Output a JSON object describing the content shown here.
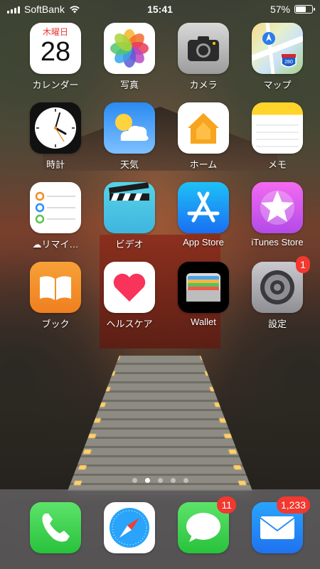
{
  "status_bar": {
    "carrier": "SoftBank",
    "time": "15:41",
    "battery_text": "57%",
    "battery_level": 0.57
  },
  "apps": [
    {
      "label": "カレンダー",
      "icon": "calendar-icon",
      "calendar_weekday": "木曜日",
      "calendar_day": "28"
    },
    {
      "label": "写真",
      "icon": "photos-icon"
    },
    {
      "label": "カメラ",
      "icon": "camera-icon"
    },
    {
      "label": "マップ",
      "icon": "maps-icon",
      "sign_text": "280"
    },
    {
      "label": "時計",
      "icon": "clock-icon"
    },
    {
      "label": "天気",
      "icon": "weather-icon"
    },
    {
      "label": "ホーム",
      "icon": "home-icon"
    },
    {
      "label": "メモ",
      "icon": "notes-icon"
    },
    {
      "label": "リマイ…",
      "icon": "reminders-icon"
    },
    {
      "label": "ビデオ",
      "icon": "videos-icon"
    },
    {
      "label": "App Store",
      "icon": "app-store-icon"
    },
    {
      "label": "iTunes Store",
      "icon": "itunes-store-icon"
    },
    {
      "label": "ブック",
      "icon": "books-icon"
    },
    {
      "label": "ヘルスケア",
      "icon": "health-icon"
    },
    {
      "label": "Wallet",
      "icon": "wallet-icon"
    },
    {
      "label": "設定",
      "icon": "settings-icon",
      "badge": "1"
    }
  ],
  "page_indicator": {
    "count": 5,
    "active": 1
  },
  "dock": [
    {
      "icon": "phone-icon"
    },
    {
      "icon": "safari-icon"
    },
    {
      "icon": "messages-icon",
      "badge": "11"
    },
    {
      "icon": "mail-icon",
      "badge": "1,233"
    }
  ]
}
